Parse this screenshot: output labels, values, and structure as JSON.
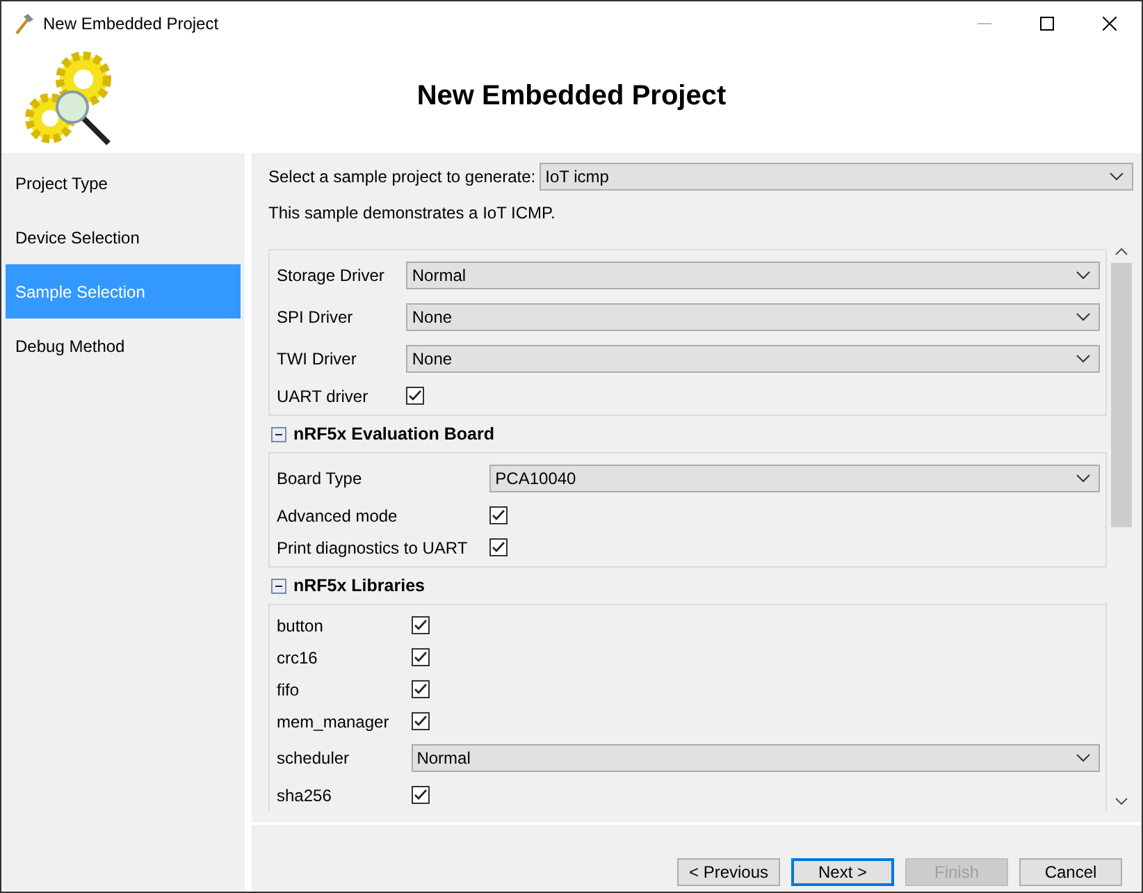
{
  "window": {
    "title": "New Embedded Project"
  },
  "header": {
    "title": "New Embedded Project"
  },
  "sidebar": {
    "items": [
      {
        "label": "Project Type",
        "selected": false
      },
      {
        "label": "Device Selection",
        "selected": false
      },
      {
        "label": "Sample Selection",
        "selected": true
      },
      {
        "label": "Debug Method",
        "selected": false
      }
    ]
  },
  "sample": {
    "label": "Select a sample project to generate:",
    "value": "IoT icmp",
    "description": "This sample demonstrates a IoT ICMP."
  },
  "groups": [
    {
      "rows": [
        {
          "kind": "select",
          "label": "Storage Driver",
          "value": "Normal"
        },
        {
          "kind": "select",
          "label": "SPI Driver",
          "value": "None"
        },
        {
          "kind": "select",
          "label": "TWI Driver",
          "value": "None"
        },
        {
          "kind": "checkbox",
          "label": "UART driver",
          "checked": true
        }
      ]
    },
    {
      "title": "nRF5x Evaluation Board",
      "expanded": true,
      "rows": [
        {
          "kind": "select",
          "label": "Board Type",
          "value": "PCA10040"
        },
        {
          "kind": "checkbox",
          "label": "Advanced mode",
          "checked": true
        },
        {
          "kind": "checkbox",
          "label": "Print diagnostics to UART",
          "checked": true
        }
      ]
    },
    {
      "title": "nRF5x Libraries",
      "expanded": true,
      "rows": [
        {
          "kind": "checkbox",
          "label": "button",
          "checked": true
        },
        {
          "kind": "checkbox",
          "label": "crc16",
          "checked": true
        },
        {
          "kind": "checkbox",
          "label": "fifo",
          "checked": true
        },
        {
          "kind": "checkbox",
          "label": "mem_manager",
          "checked": true
        },
        {
          "kind": "select",
          "label": "scheduler",
          "value": "Normal"
        },
        {
          "kind": "checkbox",
          "label": "sha256",
          "checked": true
        }
      ]
    }
  ],
  "buttons": [
    {
      "label": "< Previous",
      "disabled": false,
      "selected": false
    },
    {
      "label": "Next >",
      "disabled": false,
      "selected": true
    },
    {
      "label": "Finish",
      "disabled": true,
      "selected": false
    },
    {
      "label": "Cancel",
      "disabled": false,
      "selected": false
    }
  ]
}
